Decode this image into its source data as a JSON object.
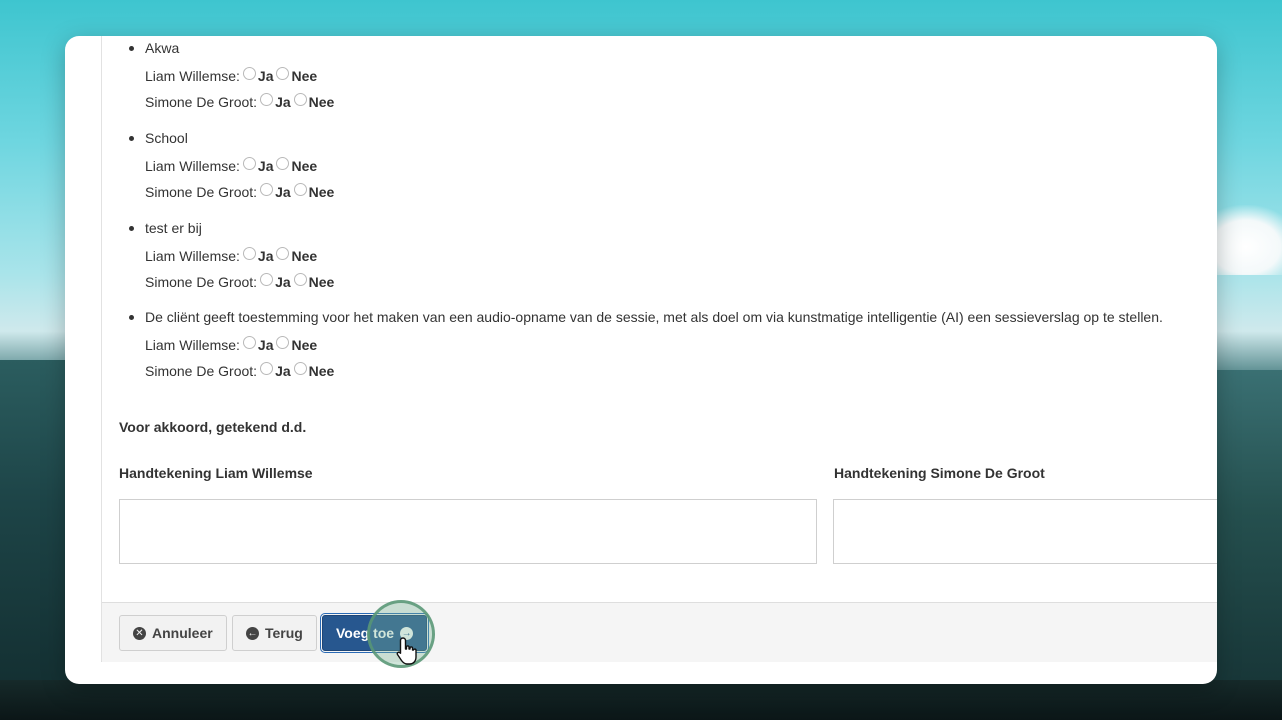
{
  "consent_items": [
    {
      "title": "Akwa",
      "answers": [
        {
          "person": "Liam Willemse:",
          "yes": "Ja",
          "no": "Nee"
        },
        {
          "person": "Simone De Groot:",
          "yes": "Ja",
          "no": "Nee"
        }
      ]
    },
    {
      "title": "School",
      "answers": [
        {
          "person": "Liam Willemse:",
          "yes": "Ja",
          "no": "Nee"
        },
        {
          "person": "Simone De Groot:",
          "yes": "Ja",
          "no": "Nee"
        }
      ]
    },
    {
      "title": "test er bij",
      "answers": [
        {
          "person": "Liam Willemse:",
          "yes": "Ja",
          "no": "Nee"
        },
        {
          "person": "Simone De Groot:",
          "yes": "Ja",
          "no": "Nee"
        }
      ]
    },
    {
      "title": "De cliënt geeft toestemming voor het maken van een audio-opname van de sessie, met als doel om via kunstmatige intelligentie (AI) een sessieverslag op te stellen.",
      "answers": [
        {
          "person": "Liam Willemse:",
          "yes": "Ja",
          "no": "Nee"
        },
        {
          "person": "Simone De Groot:",
          "yes": "Ja",
          "no": "Nee"
        }
      ]
    }
  ],
  "agreement_label": "Voor akkoord, getekend d.d.",
  "signatures": {
    "left_label": "Handtekening Liam Willemse",
    "right_label": "Handtekening Simone De Groot"
  },
  "footer": {
    "cancel_label": "Annuleer",
    "back_label": "Terug",
    "add_label": "Voeg toe"
  },
  "icons": {
    "cancel": "times-circle-icon",
    "back": "arrow-circle-left-icon",
    "add": "arrow-circle-right-icon"
  },
  "colors": {
    "primary_button": "#27578f",
    "click_highlight": "#5a9676"
  }
}
